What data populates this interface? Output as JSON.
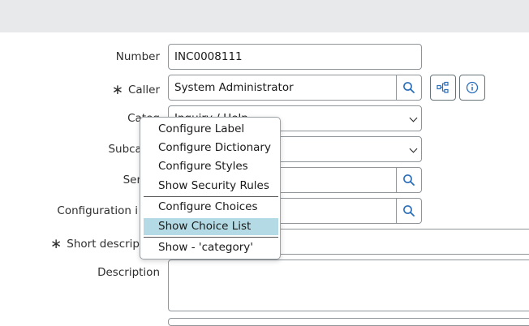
{
  "form": {
    "number": {
      "label": "Number",
      "value": "INC0008111"
    },
    "caller": {
      "label": "Caller",
      "value": "System Administrator"
    },
    "category": {
      "label": "Categ",
      "value": "Inquiry / Help"
    },
    "subcategory": {
      "label": "Subcateg",
      "value": ""
    },
    "service": {
      "label": "Ser",
      "value": ""
    },
    "configuration_item": {
      "label": "Configuration i",
      "value": ""
    },
    "short_description": {
      "label": "Short descrip",
      "value": ""
    },
    "description": {
      "label": "Description",
      "value": ""
    },
    "required_mark": "∗"
  },
  "context_menu": {
    "items": [
      "Configure Label",
      "Configure Dictionary",
      "Configure Styles",
      "Show Security Rules",
      "Configure Choices",
      "Show Choice List",
      "Show - 'category'"
    ],
    "highlighted": "Show Choice List"
  },
  "icons": [
    "search-icon",
    "hierarchy-icon",
    "info-icon"
  ]
}
